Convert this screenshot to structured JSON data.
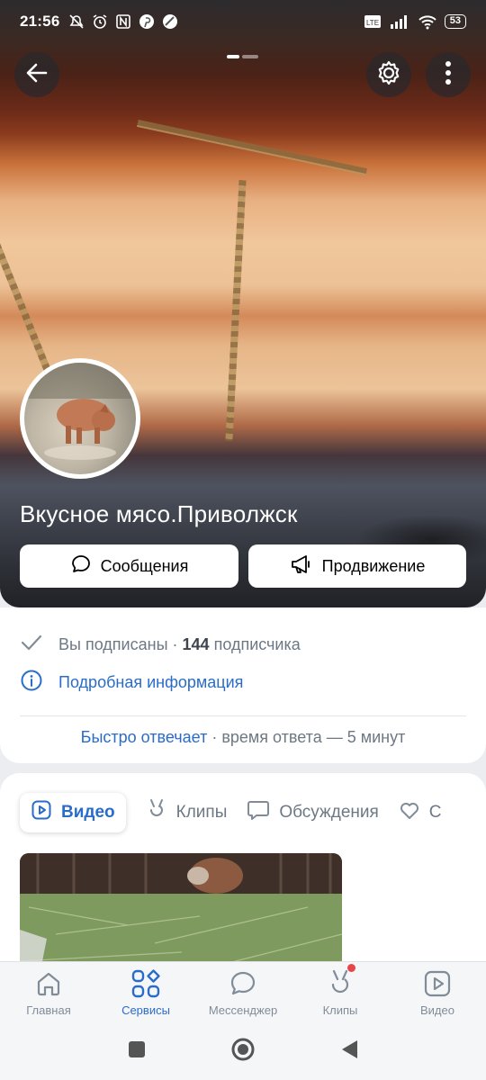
{
  "status_bar": {
    "time": "21:56",
    "battery": "53"
  },
  "group": {
    "name": "Вкусное мясо.Приволжск"
  },
  "actions": {
    "messages_label": "Сообщения",
    "promote_label": "Продвижение"
  },
  "info": {
    "subscribed_text": "Вы подписаны",
    "separator": "·",
    "subscribers_count": "144",
    "subscribers_label": "подписчика",
    "details_label": "Подробная информация",
    "fast_reply_label": "Быстро отвечает",
    "response_time_text": "· время ответа — 5 минут"
  },
  "tabs": [
    {
      "label": "Видео",
      "icon": "play-square-icon",
      "active": true
    },
    {
      "label": "Клипы",
      "icon": "clips-icon",
      "active": false
    },
    {
      "label": "Обсуждения",
      "icon": "chat-bubble-icon",
      "active": false
    },
    {
      "label": "С",
      "icon": "heart-tag-icon",
      "active": false
    }
  ],
  "bottom_nav": [
    {
      "label": "Главная",
      "icon": "home-icon",
      "active": false
    },
    {
      "label": "Сервисы",
      "icon": "services-icon",
      "active": true
    },
    {
      "label": "Мессенджер",
      "icon": "messenger-icon",
      "active": false
    },
    {
      "label": "Клипы",
      "icon": "clips-icon",
      "active": false,
      "badge": true
    },
    {
      "label": "Видео",
      "icon": "video-icon",
      "active": false
    }
  ],
  "colors": {
    "accent": "#2a6cc9",
    "muted": "#6d7885",
    "badge": "#e64646"
  }
}
